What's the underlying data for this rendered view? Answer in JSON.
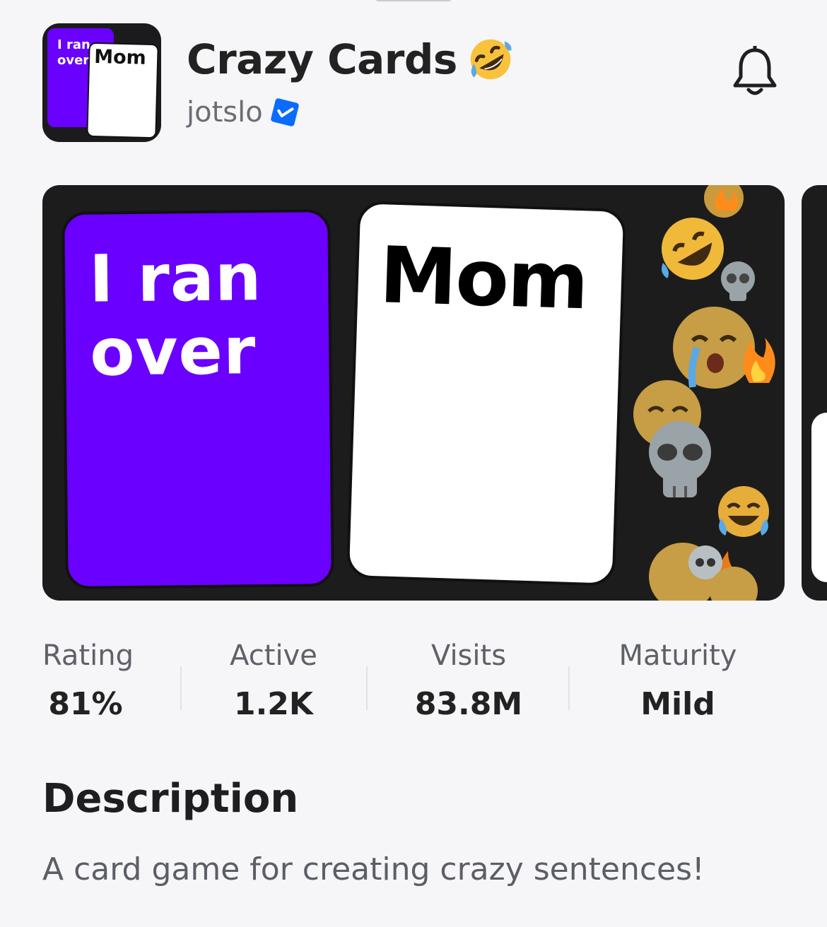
{
  "game": {
    "title": "Crazy Cards",
    "title_emoji": "rolling-on-floor-laughing-emoji",
    "creator": "jotslo",
    "creator_verified": true
  },
  "icon": {
    "card_purple_text": "I ran\nover",
    "card_white_text": "Mom"
  },
  "thumbnail": {
    "card_purple_text": "I ran\nover",
    "card_white_text": "Mom"
  },
  "stats": [
    {
      "label": "Rating",
      "value": "81%"
    },
    {
      "label": "Active",
      "value": "1.2K"
    },
    {
      "label": "Visits",
      "value": "83.8M"
    },
    {
      "label": "Maturity",
      "value": "Mild"
    }
  ],
  "description": {
    "heading": "Description",
    "text": "A card game for creating crazy sentences!"
  },
  "colors": {
    "background": "#f6f6f8",
    "card_purple": "#6a00ff",
    "verified_blue": "#0a6cff",
    "thumb_bg": "#1c1c1c"
  }
}
